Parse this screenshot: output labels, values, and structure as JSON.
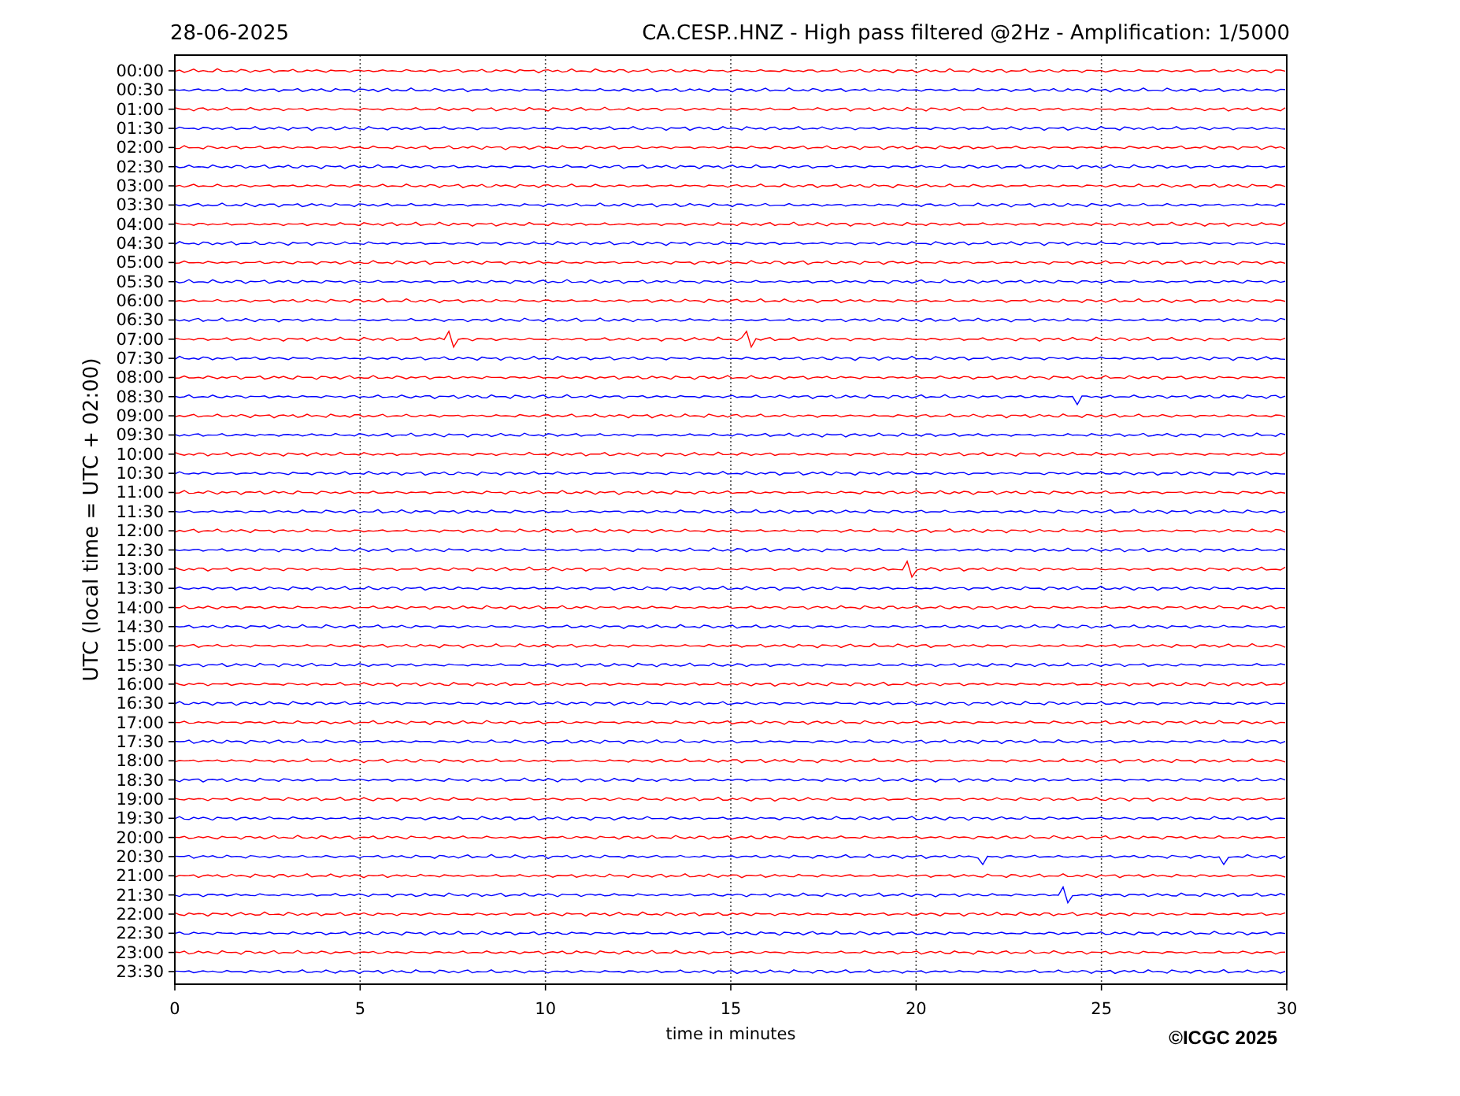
{
  "header": {
    "date": "28-06-2025",
    "title": "CA.CESP..HNZ - High pass filtered @2Hz - Amplification: 1/5000"
  },
  "y_axis": {
    "label": "UTC (local time = UTC + 02:00)"
  },
  "x_axis": {
    "label": "time in minutes",
    "ticks": [
      "0",
      "5",
      "10",
      "15",
      "20",
      "25",
      "30"
    ]
  },
  "rows": [
    {
      "time": "00:00",
      "color": "#ff0000"
    },
    {
      "time": "00:30",
      "color": "#0000ff"
    },
    {
      "time": "01:00",
      "color": "#ff0000"
    },
    {
      "time": "01:30",
      "color": "#0000ff"
    },
    {
      "time": "02:00",
      "color": "#ff0000"
    },
    {
      "time": "02:30",
      "color": "#0000ff"
    },
    {
      "time": "03:00",
      "color": "#ff0000"
    },
    {
      "time": "03:30",
      "color": "#0000ff"
    },
    {
      "time": "04:00",
      "color": "#ff0000"
    },
    {
      "time": "04:30",
      "color": "#0000ff"
    },
    {
      "time": "05:00",
      "color": "#ff0000"
    },
    {
      "time": "05:30",
      "color": "#0000ff"
    },
    {
      "time": "06:00",
      "color": "#ff0000"
    },
    {
      "time": "06:30",
      "color": "#0000ff"
    },
    {
      "time": "07:00",
      "color": "#ff0000"
    },
    {
      "time": "07:30",
      "color": "#0000ff"
    },
    {
      "time": "08:00",
      "color": "#ff0000"
    },
    {
      "time": "08:30",
      "color": "#0000ff"
    },
    {
      "time": "09:00",
      "color": "#ff0000"
    },
    {
      "time": "09:30",
      "color": "#0000ff"
    },
    {
      "time": "10:00",
      "color": "#ff0000"
    },
    {
      "time": "10:30",
      "color": "#0000ff"
    },
    {
      "time": "11:00",
      "color": "#ff0000"
    },
    {
      "time": "11:30",
      "color": "#0000ff"
    },
    {
      "time": "12:00",
      "color": "#ff0000"
    },
    {
      "time": "12:30",
      "color": "#0000ff"
    },
    {
      "time": "13:00",
      "color": "#ff0000"
    },
    {
      "time": "13:30",
      "color": "#0000ff"
    },
    {
      "time": "14:00",
      "color": "#ff0000"
    },
    {
      "time": "14:30",
      "color": "#0000ff"
    },
    {
      "time": "15:00",
      "color": "#ff0000"
    },
    {
      "time": "15:30",
      "color": "#0000ff"
    },
    {
      "time": "16:00",
      "color": "#ff0000"
    },
    {
      "time": "16:30",
      "color": "#0000ff"
    },
    {
      "time": "17:00",
      "color": "#ff0000"
    },
    {
      "time": "17:30",
      "color": "#0000ff"
    },
    {
      "time": "18:00",
      "color": "#ff0000"
    },
    {
      "time": "18:30",
      "color": "#0000ff"
    },
    {
      "time": "19:00",
      "color": "#ff0000"
    },
    {
      "time": "19:30",
      "color": "#0000ff"
    },
    {
      "time": "20:00",
      "color": "#ff0000"
    },
    {
      "time": "20:30",
      "color": "#0000ff"
    },
    {
      "time": "21:00",
      "color": "#ff0000"
    },
    {
      "time": "21:30",
      "color": "#0000ff"
    },
    {
      "time": "22:00",
      "color": "#ff0000"
    },
    {
      "time": "22:30",
      "color": "#0000ff"
    },
    {
      "time": "23:00",
      "color": "#ff0000"
    },
    {
      "time": "23:30",
      "color": "#0000ff"
    }
  ],
  "copyright": "©ICGC 2025"
}
